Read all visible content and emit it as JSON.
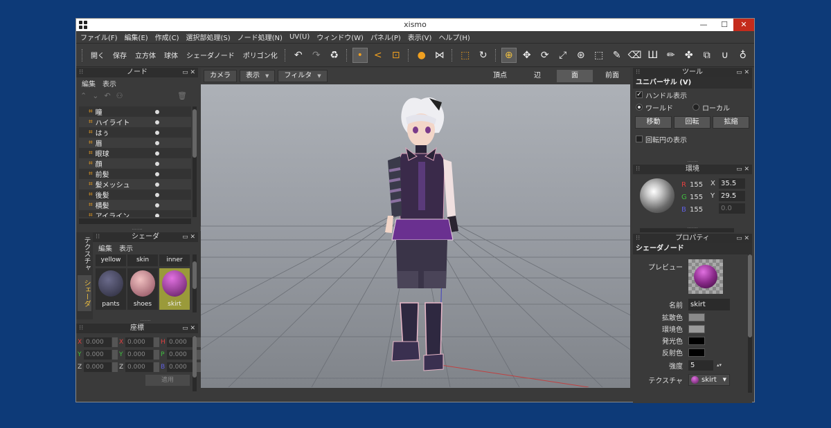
{
  "window": {
    "title": "xismo",
    "controls": [
      "—",
      "☐",
      "✕"
    ]
  },
  "menu": [
    "ファイル(F)",
    "編集(E)",
    "作成(C)",
    "選択部処理(S)",
    "ノード処理(N)",
    "UV(U)",
    "ウィンドウ(W)",
    "パネル(P)",
    "表示(V)",
    "ヘルプ(H)"
  ],
  "toolbar": {
    "open": "開く",
    "save": "保存",
    "cube": "立方体",
    "sphere": "球体",
    "shader_node": "シェーダノード",
    "polygonize": "ポリゴン化"
  },
  "node_panel": {
    "title": "ノード",
    "menu": [
      "編集",
      "表示"
    ],
    "items": [
      "瞳",
      "ハイライト",
      "はぅ",
      "眉",
      "眼球",
      "顔",
      "前髪",
      "髪メッシュ",
      "後髪",
      "横髪",
      "アイライン"
    ]
  },
  "shader_panel": {
    "title": "シェーダ",
    "menu": [
      "編集",
      "表示"
    ],
    "vtab_texture": "テクスチャ",
    "vtab_shader": "シェーダ",
    "row1": [
      "yellow",
      "skin",
      "inner"
    ],
    "row2": [
      "pants",
      "shoes",
      "skirt"
    ]
  },
  "coord_panel": {
    "title": "座標",
    "rows": [
      [
        {
          "a": "X",
          "v": "0.000"
        },
        {
          "a": "X",
          "v": "0.000"
        },
        {
          "a": "H",
          "v": "0.000"
        }
      ],
      [
        {
          "a": "Y",
          "v": "0.000"
        },
        {
          "a": "Y",
          "v": "0.000"
        },
        {
          "a": "P",
          "v": "0.000"
        }
      ],
      [
        {
          "a": "Z",
          "v": "0.000"
        },
        {
          "a": "Z",
          "v": "0.000"
        },
        {
          "a": "B",
          "v": "0.000"
        }
      ]
    ],
    "apply": "適用"
  },
  "viewport": {
    "camera": "カメラ",
    "display": "表示",
    "filter": "フィルタ",
    "modes": [
      "頂点",
      "辺",
      "面",
      "前面"
    ],
    "active_mode": "面"
  },
  "tool_panel": {
    "title": "ツール",
    "section": "ユニバーサル (V)",
    "handle": "ハンドル表示",
    "world": "ワールド",
    "local": "ローカル",
    "move": "移動",
    "rotate": "回転",
    "scale": "拡縮",
    "rotcircle": "回転円の表示"
  },
  "env_panel": {
    "title": "環境",
    "r_label": "R",
    "g_label": "G",
    "b_label": "B",
    "r": "155",
    "g": "155",
    "b": "155",
    "x_label": "X",
    "y_label": "Y",
    "x": "35.5",
    "y": "29.5",
    "z": "0.0"
  },
  "prop_panel": {
    "title": "プロパティ",
    "section": "シェーダノード",
    "preview": "プレビュー",
    "name_label": "名前",
    "name": "skirt",
    "diffuse": "拡散色",
    "ambient": "環境色",
    "emissive": "発光色",
    "specular": "反射色",
    "intensity_label": "強度",
    "intensity": "5",
    "texture_label": "テクスチャ",
    "texture": "skirt"
  },
  "colors": {
    "accent": "#f0a020",
    "titlebar_close": "#c42b1c",
    "desktop": "#0d3a78"
  }
}
